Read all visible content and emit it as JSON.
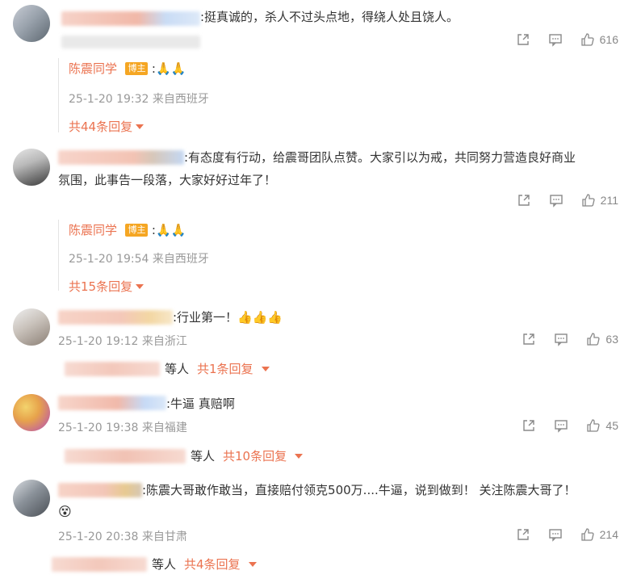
{
  "comments": [
    {
      "text": ":挺真诚的，杀人不过头点地，得绕人处且饶人。",
      "meta": "",
      "share_icon": "share-icon",
      "comment_icon": "comment-icon",
      "likes": "616",
      "reply": {
        "author": "陈震同学",
        "badge": "博主",
        "text": ":🙏🙏",
        "meta": "25-1-20 19:32 来自西班牙"
      },
      "more": "共44条回复"
    },
    {
      "text_line1": ":有态度有行动，给震哥团队点赞。大家引以为戒，共同努力营造良好商业",
      "text_line2": "氛围，此事告一段落，大家好好过年了！",
      "likes": "211",
      "reply": {
        "author": "陈震同学",
        "badge": "博主",
        "text": ":🙏🙏",
        "meta": "25-1-20 19:54 来自西班牙"
      },
      "more": "共15条回复"
    },
    {
      "text": ":行业第一！👍👍👍",
      "meta": "25-1-20 19:12 来自浙江",
      "likes": "63",
      "others": "等人",
      "more": "共1条回复"
    },
    {
      "text": ":牛逼 真赔啊",
      "meta": "25-1-20 19:38 来自福建",
      "likes": "45",
      "others": "等人",
      "more": "共10条回复"
    },
    {
      "text": ":陈震大哥敢作敢当，直接赔付领克500万....牛逼，说到做到！ 关注陈震大哥了！",
      "emoji": "😵",
      "meta": "25-1-20 20:38 来自甘肃",
      "likes": "214",
      "others": "等人",
      "more": "共4条回复"
    }
  ],
  "colors": {
    "accent": "#eb7350",
    "badge": "#f5a623",
    "meta": "#999999"
  }
}
